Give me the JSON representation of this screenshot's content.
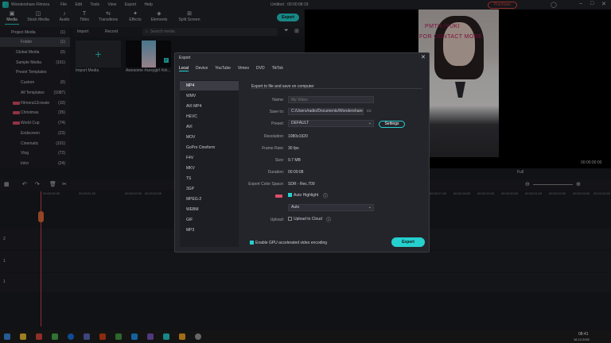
{
  "app": {
    "name": "Wondershare Filmora",
    "menu": [
      "File",
      "Edit",
      "Tools",
      "View",
      "Export",
      "Help"
    ],
    "project_title": "Untitled : 00:00:08:19",
    "purchase": "Purchase"
  },
  "toolbar": {
    "items": [
      {
        "label": "Media",
        "icon": "▣"
      },
      {
        "label": "Stock Media",
        "icon": "◫"
      },
      {
        "label": "Audio",
        "icon": "♪"
      },
      {
        "label": "Titles",
        "icon": "T"
      },
      {
        "label": "Transitions",
        "icon": "⇆"
      },
      {
        "label": "Effects",
        "icon": "✦"
      },
      {
        "label": "Elements",
        "icon": "◈"
      },
      {
        "label": "Split Screen",
        "icon": "⊞"
      }
    ],
    "export_label": "Export"
  },
  "sidebar": {
    "items": [
      {
        "label": "Project Media",
        "count": "(1)",
        "hot": false
      },
      {
        "label": "Folder",
        "count": "(1)",
        "hot": false
      },
      {
        "label": "Global Media",
        "count": "(0)",
        "hot": false
      },
      {
        "label": "Sample Media",
        "count": "(101)",
        "hot": false
      },
      {
        "label": "Preset Templates",
        "count": "",
        "hot": false
      },
      {
        "label": "Custom",
        "count": "(0)",
        "hot": false
      },
      {
        "label": "All Templates",
        "count": "(1087)",
        "hot": false
      },
      {
        "label": "Filmora12create",
        "count": "(10)",
        "hot": true
      },
      {
        "label": "Christmas",
        "count": "(35)",
        "hot": true
      },
      {
        "label": "World Cup",
        "count": "(74)",
        "hot": true
      },
      {
        "label": "Endscreen",
        "count": "(23)",
        "hot": false
      },
      {
        "label": "Cinematic",
        "count": "(101)",
        "hot": false
      },
      {
        "label": "Vlog",
        "count": "(72)",
        "hot": false
      },
      {
        "label": "Intro",
        "count": "(24)",
        "hot": false
      }
    ]
  },
  "media": {
    "import_label": "Import",
    "record_label": "Record",
    "search_placeholder": "Search media",
    "thumbs": [
      {
        "label": "Import Media"
      },
      {
        "label": "Awesome #sexygirl #sh..."
      }
    ]
  },
  "preview": {
    "watermark_line1": "PMTH                /YUKI",
    "watermark_line2": "FOR CONTACT            MORE",
    "timecode": "00:00:00:00",
    "quality": "Full"
  },
  "timeline": {
    "ruler_labels": [
      "00:00:00:00",
      "00:00:01:00",
      "00:00:02:00",
      "00:00:03:00",
      "00:00:04:00",
      "00:00:05:00",
      "00:00:06:00",
      "00:00:07:00",
      "00:00:08:00",
      "00:00:17:00",
      "00:00:18:00",
      "00:00:19:00",
      "00:00:20:00",
      "00:00:21:00",
      "00:00:22:00",
      "00:00:23:00",
      "00:00:24:00"
    ],
    "tracks": [
      {
        "label": "2"
      },
      {
        "label": "1"
      },
      {
        "label": "1"
      }
    ]
  },
  "dialog": {
    "title": "Export",
    "close": "✕",
    "tabs": [
      "Local",
      "Device",
      "YouTube",
      "Vimeo",
      "DVD",
      "TikTok"
    ],
    "formats": [
      "MP4",
      "WMV",
      "AVI MP4",
      "HEVC",
      "AVI",
      "MOV",
      "GoPro Cineform",
      "F4V",
      "MKV",
      "TS",
      "3GP",
      "MPEG-2",
      "WEBM",
      "GIF",
      "MP3"
    ],
    "heading": "Export to file and save on computer",
    "name_label": "Name:",
    "name_placeholder": "My Video",
    "save_label": "Save to:",
    "save_value": "C:/Users/radio/Documents/Wondershare/",
    "preset_label": "Preset:",
    "preset_value": "DEFAULT",
    "settings_label": "Settings",
    "resolution_label": "Resolution:",
    "resolution_value": "1080x1920",
    "framerate_label": "Frame Rate:",
    "framerate_value": "30 fps",
    "size_label": "Size:",
    "size_value": "9.7 MB",
    "duration_label": "Duration:",
    "duration_value": "00:00:08",
    "colorspace_label": "Export Color Space:",
    "colorspace_value": "SDR - Rec.709",
    "auto_highlight_label": "Auto Highlight",
    "auto_value": "Auto",
    "upload_label": "Upload:",
    "upload_cloud": "Upload to Cloud",
    "gpu_label": "Enable GPU accelerated video encoding",
    "export_label": "Export"
  },
  "taskbar": {
    "time": "08:41",
    "date": "16.12.2022"
  }
}
